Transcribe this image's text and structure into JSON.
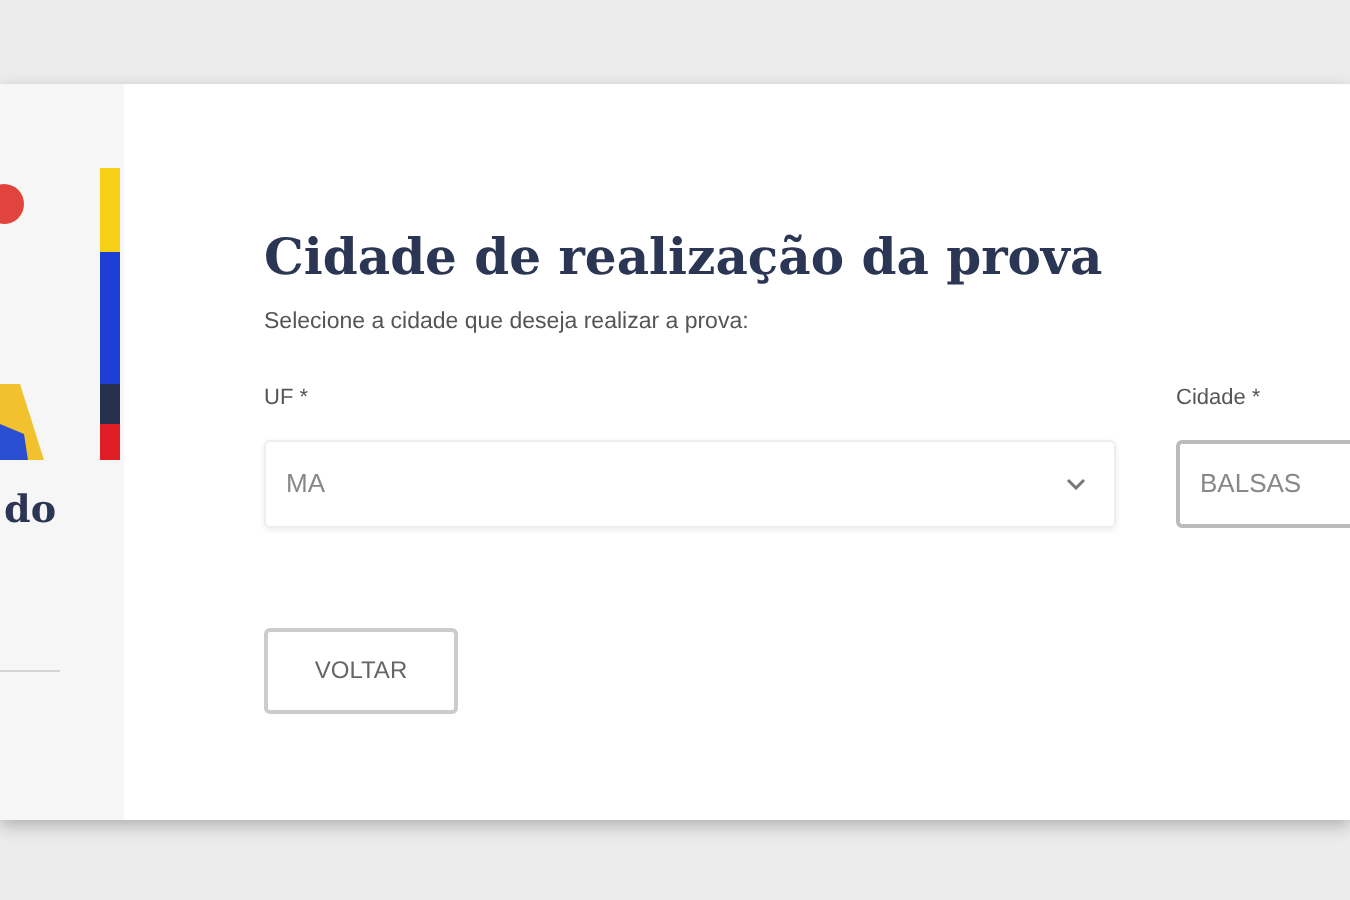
{
  "sidebar": {
    "heading": "do"
  },
  "form": {
    "title": "Cidade de realização da prova",
    "subtitle": "Selecione a cidade que deseja realizar a prova:",
    "fields": [
      {
        "kind": "select",
        "label": "UF *",
        "value": "MA"
      },
      {
        "kind": "input",
        "label": "Cidade *",
        "value": "BALSAS"
      }
    ],
    "buttons": [
      "VOLTAR"
    ]
  }
}
